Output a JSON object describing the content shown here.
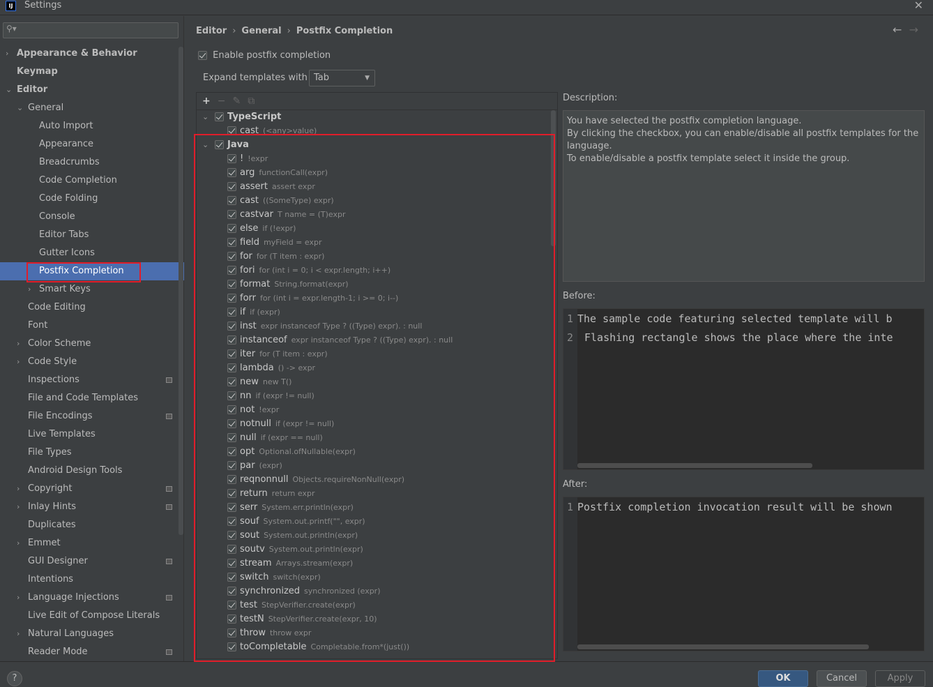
{
  "window": {
    "title": "Settings",
    "logo": "IJ"
  },
  "search": {
    "icon": "search-icon",
    "value": ""
  },
  "sidebar": {
    "items": [
      {
        "label": "Appearance & Behavior",
        "level": 0,
        "arrow": "›",
        "bold": true
      },
      {
        "label": "Keymap",
        "level": 0,
        "arrow": "",
        "bold": true
      },
      {
        "label": "Editor",
        "level": 0,
        "arrow": "⌄",
        "bold": true
      },
      {
        "label": "General",
        "level": 1,
        "arrow": "⌄"
      },
      {
        "label": "Auto Import",
        "level": 2,
        "arrow": ""
      },
      {
        "label": "Appearance",
        "level": 2,
        "arrow": ""
      },
      {
        "label": "Breadcrumbs",
        "level": 2,
        "arrow": ""
      },
      {
        "label": "Code Completion",
        "level": 2,
        "arrow": ""
      },
      {
        "label": "Code Folding",
        "level": 2,
        "arrow": ""
      },
      {
        "label": "Console",
        "level": 2,
        "arrow": ""
      },
      {
        "label": "Editor Tabs",
        "level": 2,
        "arrow": ""
      },
      {
        "label": "Gutter Icons",
        "level": 2,
        "arrow": ""
      },
      {
        "label": "Postfix Completion",
        "level": 2,
        "arrow": "",
        "selected": true
      },
      {
        "label": "Smart Keys",
        "level": 2,
        "arrow": "›"
      },
      {
        "label": "Code Editing",
        "level": 1,
        "arrow": ""
      },
      {
        "label": "Font",
        "level": 1,
        "arrow": ""
      },
      {
        "label": "Color Scheme",
        "level": 1,
        "arrow": "›"
      },
      {
        "label": "Code Style",
        "level": 1,
        "arrow": "›"
      },
      {
        "label": "Inspections",
        "level": 1,
        "arrow": "",
        "badge": true
      },
      {
        "label": "File and Code Templates",
        "level": 1,
        "arrow": ""
      },
      {
        "label": "File Encodings",
        "level": 1,
        "arrow": "",
        "badge": true
      },
      {
        "label": "Live Templates",
        "level": 1,
        "arrow": ""
      },
      {
        "label": "File Types",
        "level": 1,
        "arrow": ""
      },
      {
        "label": "Android Design Tools",
        "level": 1,
        "arrow": ""
      },
      {
        "label": "Copyright",
        "level": 1,
        "arrow": "›",
        "badge": true
      },
      {
        "label": "Inlay Hints",
        "level": 1,
        "arrow": "›",
        "badge": true
      },
      {
        "label": "Duplicates",
        "level": 1,
        "arrow": ""
      },
      {
        "label": "Emmet",
        "level": 1,
        "arrow": "›"
      },
      {
        "label": "GUI Designer",
        "level": 1,
        "arrow": "",
        "badge": true
      },
      {
        "label": "Intentions",
        "level": 1,
        "arrow": ""
      },
      {
        "label": "Language Injections",
        "level": 1,
        "arrow": "›",
        "badge": true
      },
      {
        "label": "Live Edit of Compose Literals",
        "level": 1,
        "arrow": ""
      },
      {
        "label": "Natural Languages",
        "level": 1,
        "arrow": "›"
      },
      {
        "label": "Reader Mode",
        "level": 1,
        "arrow": "",
        "badge": true
      }
    ]
  },
  "breadcrumb": [
    "Editor",
    "General",
    "Postfix Completion"
  ],
  "enable_label": "Enable postfix completion",
  "enable_checked": true,
  "expand": {
    "label": "Expand templates with",
    "value": "Tab"
  },
  "toolbar": {
    "add": "+",
    "remove": "−",
    "edit": "✎",
    "copy": "⧉"
  },
  "tree": {
    "groups": [
      {
        "name": "TypeScript",
        "checked": true,
        "items": [
          {
            "key": "cast",
            "hint": "(<any>value)"
          }
        ]
      },
      {
        "name": "Java",
        "checked": true,
        "items": [
          {
            "key": "!",
            "hint": "!expr"
          },
          {
            "key": "arg",
            "hint": "functionCall(expr)"
          },
          {
            "key": "assert",
            "hint": "assert expr"
          },
          {
            "key": "cast",
            "hint": "((SomeType) expr)"
          },
          {
            "key": "castvar",
            "hint": "T name = (T)expr"
          },
          {
            "key": "else",
            "hint": "if (!expr)"
          },
          {
            "key": "field",
            "hint": "myField = expr"
          },
          {
            "key": "for",
            "hint": "for (T item : expr)"
          },
          {
            "key": "fori",
            "hint": "for (int i = 0; i < expr.length; i++)"
          },
          {
            "key": "format",
            "hint": "String.format(expr)"
          },
          {
            "key": "forr",
            "hint": "for (int i = expr.length-1; i >= 0; i--)"
          },
          {
            "key": "if",
            "hint": "if (expr)"
          },
          {
            "key": "inst",
            "hint": "expr instanceof Type ? ((Type) expr). : null"
          },
          {
            "key": "instanceof",
            "hint": "expr instanceof Type ? ((Type) expr). : null"
          },
          {
            "key": "iter",
            "hint": "for (T item : expr)"
          },
          {
            "key": "lambda",
            "hint": "() -> expr"
          },
          {
            "key": "new",
            "hint": "new T()"
          },
          {
            "key": "nn",
            "hint": "if (expr != null)"
          },
          {
            "key": "not",
            "hint": "!expr"
          },
          {
            "key": "notnull",
            "hint": "if (expr != null)"
          },
          {
            "key": "null",
            "hint": "if (expr == null)"
          },
          {
            "key": "opt",
            "hint": "Optional.ofNullable(expr)"
          },
          {
            "key": "par",
            "hint": "(expr)"
          },
          {
            "key": "reqnonnull",
            "hint": "Objects.requireNonNull(expr)"
          },
          {
            "key": "return",
            "hint": "return expr"
          },
          {
            "key": "serr",
            "hint": "System.err.println(expr)"
          },
          {
            "key": "souf",
            "hint": "System.out.printf(\"\", expr)"
          },
          {
            "key": "sout",
            "hint": "System.out.println(expr)"
          },
          {
            "key": "soutv",
            "hint": "System.out.println(expr)"
          },
          {
            "key": "stream",
            "hint": "Arrays.stream(expr)"
          },
          {
            "key": "switch",
            "hint": "switch(expr)"
          },
          {
            "key": "synchronized",
            "hint": "synchronized (expr)"
          },
          {
            "key": "test",
            "hint": "StepVerifier.create(expr)"
          },
          {
            "key": "testN",
            "hint": "StepVerifier.create(expr, 10)"
          },
          {
            "key": "throw",
            "hint": "throw expr"
          },
          {
            "key": "toCompletable",
            "hint": "Completable.from*(just())"
          }
        ]
      }
    ]
  },
  "description": {
    "label": "Description:",
    "lines": [
      "You have selected the postfix completion language.",
      "By clicking the checkbox, you can enable/disable all postfix templates for the language.",
      "To enable/disable a postfix template select it inside the group."
    ]
  },
  "before": {
    "label": "Before:",
    "lines": [
      {
        "n": "1",
        "text": "The sample code featuring selected template will b"
      },
      {
        "n": "2",
        "text": "Flashing rectangle shows the place where the inte"
      }
    ]
  },
  "after": {
    "label": "After:",
    "lines": [
      {
        "n": "1",
        "text": "Postfix completion invocation result will be shown"
      }
    ]
  },
  "buttons": {
    "help": "?",
    "ok": "OK",
    "cancel": "Cancel",
    "apply": "Apply"
  },
  "colors": {
    "selection": "#4b6eaf",
    "ok": "#365880",
    "annotation": "#e11d2a"
  }
}
